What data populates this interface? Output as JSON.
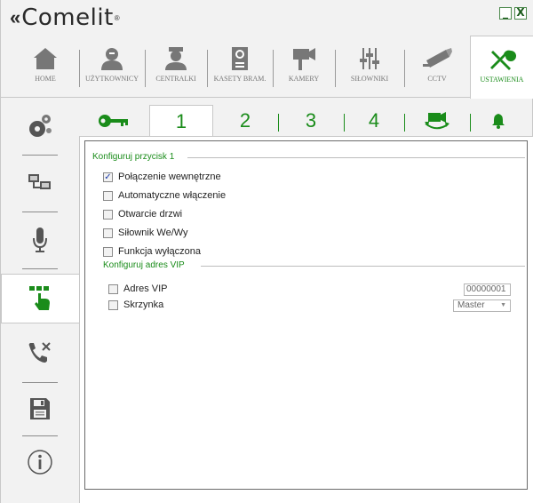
{
  "app": {
    "brand": "Comelit",
    "brand_mark": "«",
    "brand_reg": "®",
    "min_label": "_",
    "close_label": "X"
  },
  "toolbar": [
    {
      "label": "HOME",
      "icon": "home-icon"
    },
    {
      "label": "UŻYTKOWNICY",
      "icon": "user-icon"
    },
    {
      "label": "CENTRALKI",
      "icon": "concierge-icon"
    },
    {
      "label": "KASETY BRAM.",
      "icon": "door-panel-icon"
    },
    {
      "label": "KAMERY",
      "icon": "camera-icon"
    },
    {
      "label": "SIŁOWNIKI",
      "icon": "actuator-icon"
    },
    {
      "label": "CCTV",
      "icon": "cctv-icon"
    },
    {
      "label": "USTAWIENIA",
      "icon": "settings-tools-icon",
      "active": true
    }
  ],
  "sidebar": [
    {
      "icon": "gears-icon"
    },
    {
      "icon": "network-icon"
    },
    {
      "icon": "microphone-icon"
    },
    {
      "icon": "button-press-icon",
      "active": true
    },
    {
      "icon": "phone-tools-icon"
    },
    {
      "icon": "save-icon"
    },
    {
      "icon": "info-icon"
    }
  ],
  "tabs": {
    "t1": "1",
    "t2": "2",
    "t3": "3",
    "t4": "4"
  },
  "group1": {
    "title": "Konfiguruj przycisk 1",
    "options": [
      {
        "label": "Połączenie wewnętrzne",
        "checked": true
      },
      {
        "label": "Automatyczne włączenie",
        "checked": false
      },
      {
        "label": "Otwarcie drzwi",
        "checked": false
      },
      {
        "label": "Siłownik We/Wy",
        "checked": false
      },
      {
        "label": "Funkcja wyłączona",
        "checked": false
      }
    ]
  },
  "group2": {
    "title": "Konfiguruj adres VIP",
    "vip_label": "Adres VIP",
    "vip_value": "00000001",
    "box_label": "Skrzynka",
    "box_value": "Master",
    "box_arrow": "▼"
  },
  "colors": {
    "accent": "#1a8c1a",
    "icon_gray": "#666666"
  }
}
